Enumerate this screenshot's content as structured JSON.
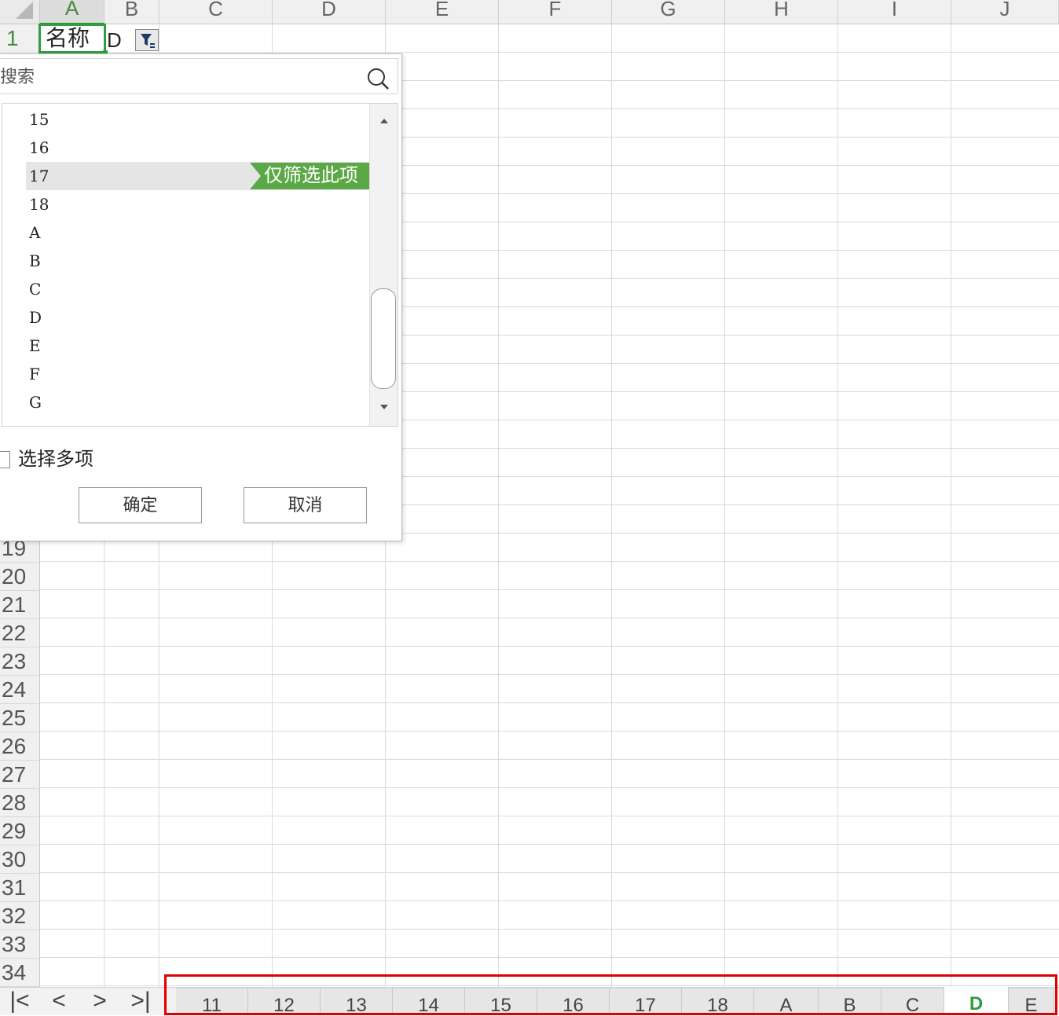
{
  "columns": [
    "A",
    "B",
    "C",
    "D",
    "E",
    "F",
    "G",
    "H",
    "I",
    "J"
  ],
  "active_column": "A",
  "rows": {
    "first": "1",
    "visible_below_dropdown": [
      "19",
      "20",
      "21",
      "22",
      "23",
      "24",
      "25",
      "26",
      "27",
      "28",
      "29",
      "30",
      "31",
      "32",
      "33",
      "34"
    ]
  },
  "cells": {
    "A1": "名称",
    "B1": "D"
  },
  "filter_dropdown": {
    "search_placeholder": "搜索",
    "items": [
      "15",
      "16",
      "17",
      "18",
      "A",
      "B",
      "C",
      "D",
      "E",
      "F",
      "G"
    ],
    "hovered_item": "17",
    "only_filter_label": "仅筛选此项",
    "multi_select_label": "选择多项",
    "multi_select_checked": false,
    "ok_label": "确定",
    "cancel_label": "取消"
  },
  "sheet_nav": {
    "first": "|<",
    "prev": "<",
    "next": ">",
    "last": ">|"
  },
  "sheet_tabs": [
    "11",
    "12",
    "13",
    "14",
    "15",
    "16",
    "17",
    "18",
    "A",
    "B",
    "C",
    "D",
    "E"
  ],
  "active_sheet": "D",
  "colors": {
    "accent_green": "#2e9e3e",
    "highlight_red": "#e00000",
    "only_filter_bg": "#5aa946"
  }
}
